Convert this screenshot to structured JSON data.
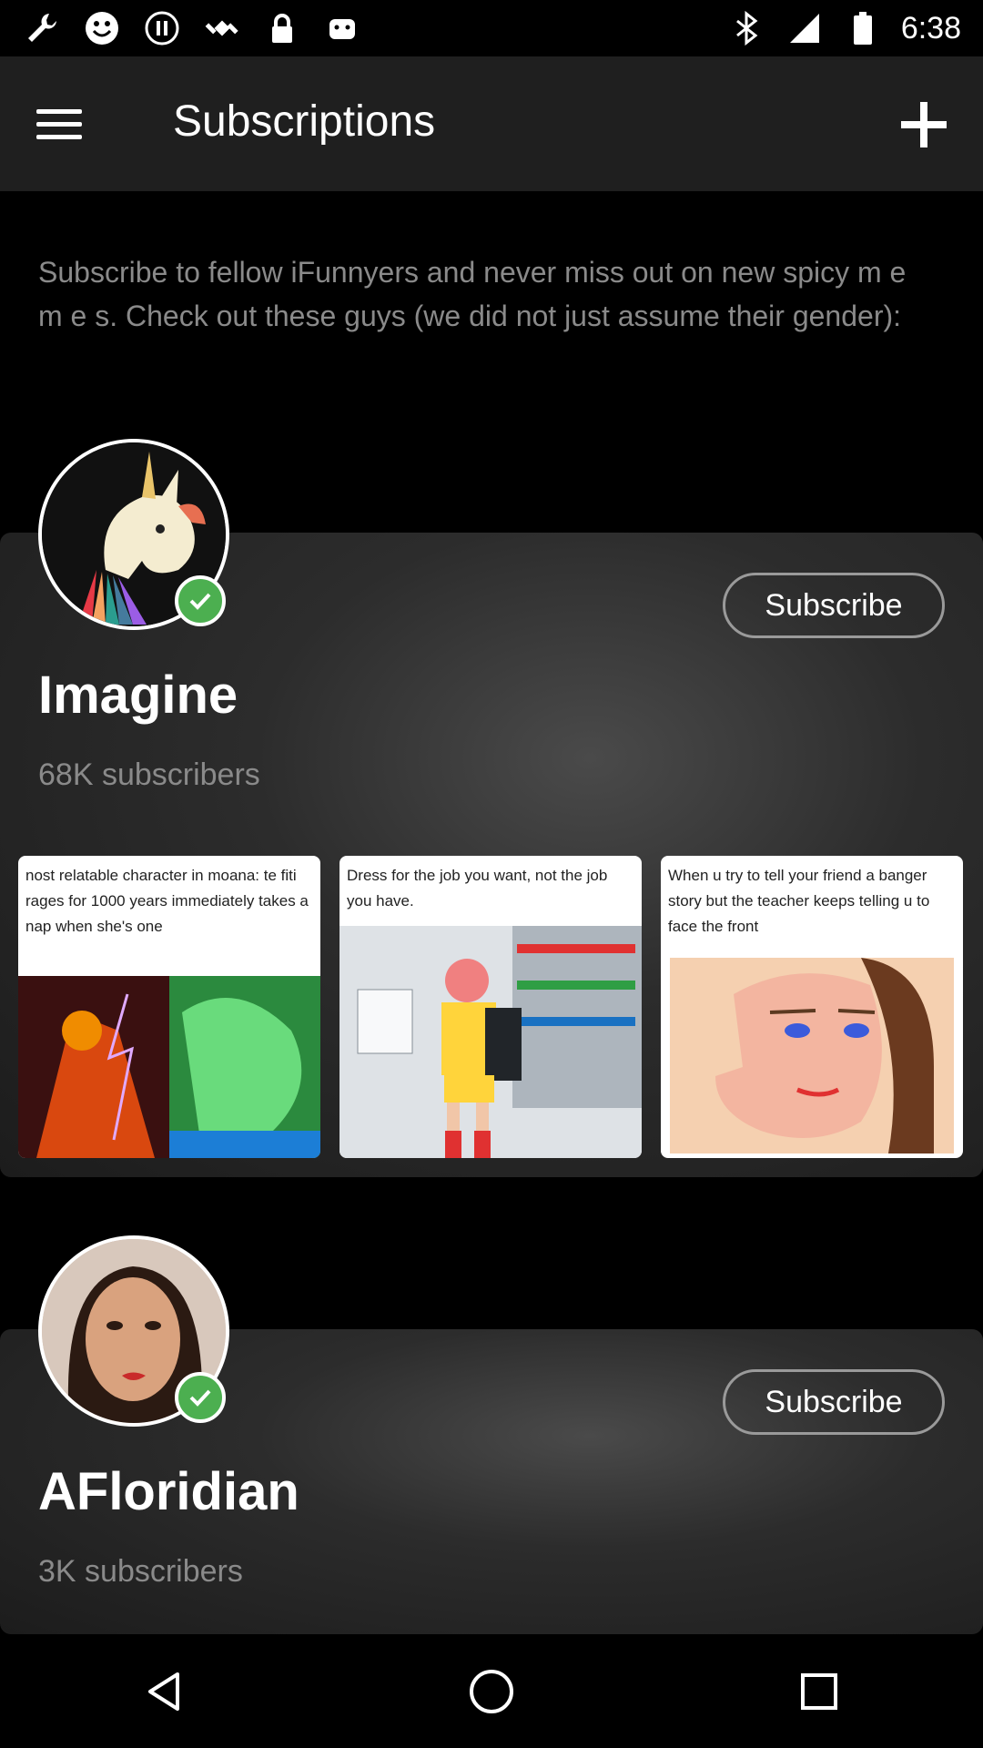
{
  "status_bar": {
    "time": "6:38",
    "left_icons": [
      "wrench-icon",
      "smiley-icon",
      "pause-icon",
      "fake-gps-icon",
      "lock-icon",
      "android-icon"
    ],
    "right_icons": [
      "bluetooth-icon",
      "signal-icon",
      "battery-icon"
    ]
  },
  "app_bar": {
    "title": "Subscriptions",
    "menu_icon": "hamburger-menu-icon",
    "add_icon": "plus-icon"
  },
  "intro_text": "Subscribe to fellow iFunnyers and never miss out on new spicy m e m e s. Check out these guys (we did not just assume their gender):",
  "users": [
    {
      "name": "Imagine",
      "subscribers": "68K subscribers",
      "subscribe_label": "Subscribe",
      "verified": true,
      "thumbnails": [
        {
          "caption": "nost relatable character in moana: te fiti rages for 1000 years immediately takes a nap when she's one"
        },
        {
          "caption": "Dress for the job you want, not the job you have."
        },
        {
          "caption": "When u try to tell your friend a banger story but the teacher keeps telling u to face the front"
        }
      ]
    },
    {
      "name": "AFloridian",
      "subscribers": "3K subscribers",
      "subscribe_label": "Subscribe",
      "verified": true
    }
  ],
  "nav_bar": {
    "back_icon": "back-triangle-icon",
    "home_icon": "home-circle-icon",
    "recents_icon": "recents-square-icon"
  },
  "colors": {
    "app_bar_bg": "#1f1f1f",
    "background": "#000000",
    "muted_text": "#8a8a8a",
    "verified_green": "#4caf50"
  }
}
